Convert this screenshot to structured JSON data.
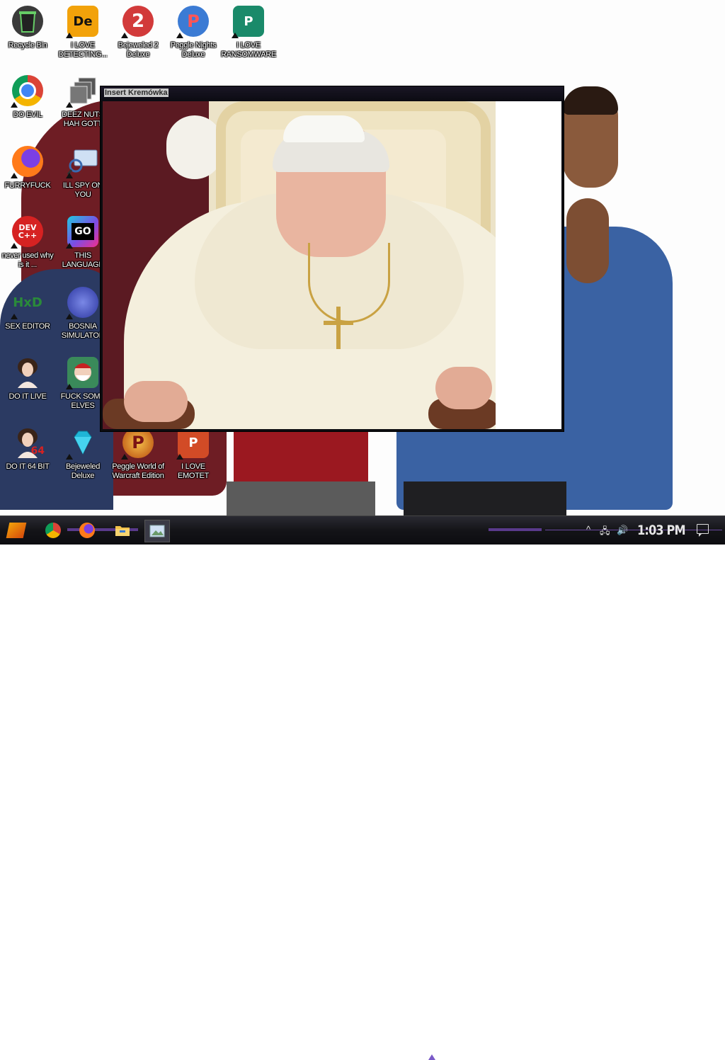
{
  "desktop": {
    "icons": [
      {
        "label": "Recycle Bin",
        "glyph": "",
        "bg": "#5a5a5a",
        "icon": "recycle-bin-icon"
      },
      {
        "label": "I LOVE DETECTING...",
        "glyph": "De",
        "bg": "#f2a20a",
        "icon": "detect-it-easy-icon"
      },
      {
        "label": "Bejeweled 2 Deluxe",
        "glyph": "2",
        "bg": "#d23a3a",
        "icon": "bejeweled-2-icon"
      },
      {
        "label": "Peggle Nights Deluxe",
        "glyph": "P",
        "bg": "#3b7bd4",
        "icon": "peggle-nights-icon"
      },
      {
        "label": "I LOVE RANSOMWARE",
        "glyph": "P",
        "bg": "#1a8a6a",
        "icon": "publisher-icon"
      },
      {
        "label": "DO EVIL",
        "glyph": "",
        "bg": "#ffffff",
        "icon": "chrome-icon"
      },
      {
        "label": "DEEZ NUTS HAH GOTT",
        "glyph": "",
        "bg": "#6a6a6a",
        "icon": "stacked-windows-icon"
      },
      {
        "label": "FURRYFUCK",
        "glyph": "",
        "bg": "#e8641f",
        "icon": "firefox-icon"
      },
      {
        "label": "ILL SPY ON YOU",
        "glyph": "",
        "bg": "#a9c4e4",
        "icon": "magnifier-icon"
      },
      {
        "label": "never used why is it ...",
        "glyph": "DEV C++",
        "bg": "#d62222",
        "icon": "dev-cpp-icon"
      },
      {
        "label": "THIS LANGUAGE",
        "glyph": "GO",
        "bg": "#222222",
        "icon": "goland-icon"
      },
      {
        "label": "SEX EDITOR",
        "glyph": "HxD",
        "bg": "#ffffff",
        "icon": "hxd-icon"
      },
      {
        "label": "BOSNIA SIMULATOR",
        "glyph": "",
        "bg": "#4b5cc4",
        "icon": "virus-icon"
      },
      {
        "label": "DO IT LIVE",
        "glyph": "",
        "bg": "#8b6a4f",
        "icon": "portrait-icon"
      },
      {
        "label": "FUCK SOME ELVES",
        "glyph": "",
        "bg": "#3a8a5a",
        "icon": "santa-icon"
      },
      {
        "label": "DO IT 64 BIT",
        "glyph": "64",
        "bg": "#8b6a4f",
        "icon": "portrait-64-icon"
      },
      {
        "label": "Bejeweled Deluxe",
        "glyph": "",
        "bg": "#1fb5d6",
        "icon": "diamond-icon"
      },
      {
        "label": "Peggle World of Warcraft Edition",
        "glyph": "P",
        "bg": "#d4601a",
        "icon": "peggle-wow-icon"
      },
      {
        "label": "I LOVE EMOTET",
        "glyph": "P",
        "bg": "#d24b26",
        "icon": "powerpoint-icon"
      }
    ]
  },
  "window": {
    "title": "Insert Kremówka"
  },
  "taskbar": {
    "clock": "1:03 PM",
    "tray_chevron": "^",
    "network_glyph": "🖧",
    "volume_glyph": "🔊",
    "colors": {
      "accent": "#5a3a8c"
    }
  }
}
